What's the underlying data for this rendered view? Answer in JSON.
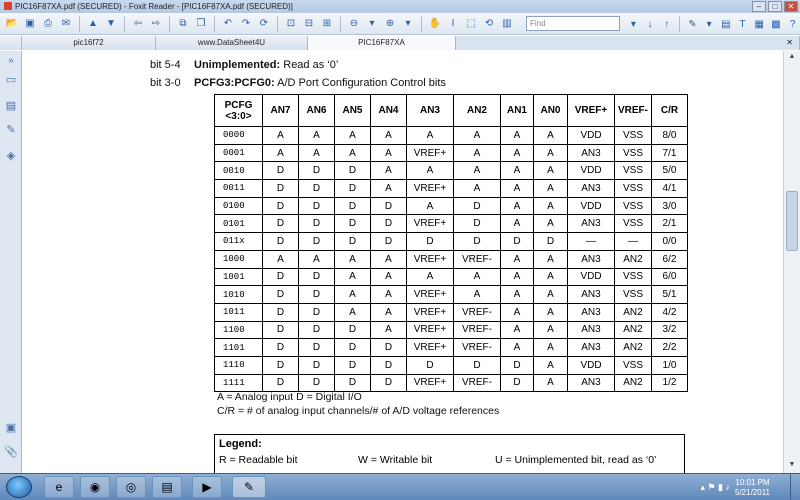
{
  "window": {
    "title": "PIC16F87XA.pdf (SECURED) - Foxit Reader - [PIC16F87XA.pdf (SECURED)]",
    "minimize": "–",
    "maximize": "□",
    "close": "✕"
  },
  "toolbar": {
    "find_placeholder": "Find"
  },
  "tabs": [
    {
      "label": "pic16f72",
      "active": false
    },
    {
      "label": "www.DataSheet4U",
      "active": false
    },
    {
      "label": "PIC16F87XA",
      "active": true
    }
  ],
  "doc": {
    "bit54": {
      "bits": "bit 5-4",
      "name": "Unimplemented:",
      "desc": " Read as ‘0’"
    },
    "bit30": {
      "bits": "bit 3-0",
      "name": "PCFG3:PCFG0:",
      "desc": " A/D Port Configuration Control bits"
    },
    "table": {
      "headers": [
        "PCFG <3:0>",
        "AN7",
        "AN6",
        "AN5",
        "AN4",
        "AN3",
        "AN2",
        "AN1",
        "AN0",
        "VREF+",
        "VREF-",
        "C/R"
      ],
      "rows": [
        [
          "0000",
          "A",
          "A",
          "A",
          "A",
          "A",
          "A",
          "A",
          "A",
          "VDD",
          "VSS",
          "8/0"
        ],
        [
          "0001",
          "A",
          "A",
          "A",
          "A",
          "VREF+",
          "A",
          "A",
          "A",
          "AN3",
          "VSS",
          "7/1"
        ],
        [
          "0010",
          "D",
          "D",
          "D",
          "A",
          "A",
          "A",
          "A",
          "A",
          "VDD",
          "VSS",
          "5/0"
        ],
        [
          "0011",
          "D",
          "D",
          "D",
          "A",
          "VREF+",
          "A",
          "A",
          "A",
          "AN3",
          "VSS",
          "4/1"
        ],
        [
          "0100",
          "D",
          "D",
          "D",
          "D",
          "A",
          "D",
          "A",
          "A",
          "VDD",
          "VSS",
          "3/0"
        ],
        [
          "0101",
          "D",
          "D",
          "D",
          "D",
          "VREF+",
          "D",
          "A",
          "A",
          "AN3",
          "VSS",
          "2/1"
        ],
        [
          "011x",
          "D",
          "D",
          "D",
          "D",
          "D",
          "D",
          "D",
          "D",
          "—",
          "—",
          "0/0"
        ],
        [
          "1000",
          "A",
          "A",
          "A",
          "A",
          "VREF+",
          "VREF-",
          "A",
          "A",
          "AN3",
          "AN2",
          "6/2"
        ],
        [
          "1001",
          "D",
          "D",
          "A",
          "A",
          "A",
          "A",
          "A",
          "A",
          "VDD",
          "VSS",
          "6/0"
        ],
        [
          "1010",
          "D",
          "D",
          "A",
          "A",
          "VREF+",
          "A",
          "A",
          "A",
          "AN3",
          "VSS",
          "5/1"
        ],
        [
          "1011",
          "D",
          "D",
          "A",
          "A",
          "VREF+",
          "VREF-",
          "A",
          "A",
          "AN3",
          "AN2",
          "4/2"
        ],
        [
          "1100",
          "D",
          "D",
          "D",
          "A",
          "VREF+",
          "VREF-",
          "A",
          "A",
          "AN3",
          "AN2",
          "3/2"
        ],
        [
          "1101",
          "D",
          "D",
          "D",
          "D",
          "VREF+",
          "VREF-",
          "A",
          "A",
          "AN3",
          "AN2",
          "2/2"
        ],
        [
          "1110",
          "D",
          "D",
          "D",
          "D",
          "D",
          "D",
          "D",
          "A",
          "VDD",
          "VSS",
          "1/0"
        ],
        [
          "1111",
          "D",
          "D",
          "D",
          "D",
          "VREF+",
          "VREF-",
          "D",
          "A",
          "AN3",
          "AN2",
          "1/2"
        ]
      ]
    },
    "note1": "A = Analog input    D = Digital I/O",
    "note2": "C/R = # of analog input channels/# of A/D voltage references",
    "legend": {
      "title": "Legend:",
      "r": "R = Readable bit",
      "w": "W = Writable bit",
      "u": "U = Unimplemented bit, read as ‘0’"
    }
  },
  "taskbar": {
    "time": "10:01 PM",
    "date": "5/21/2011"
  }
}
